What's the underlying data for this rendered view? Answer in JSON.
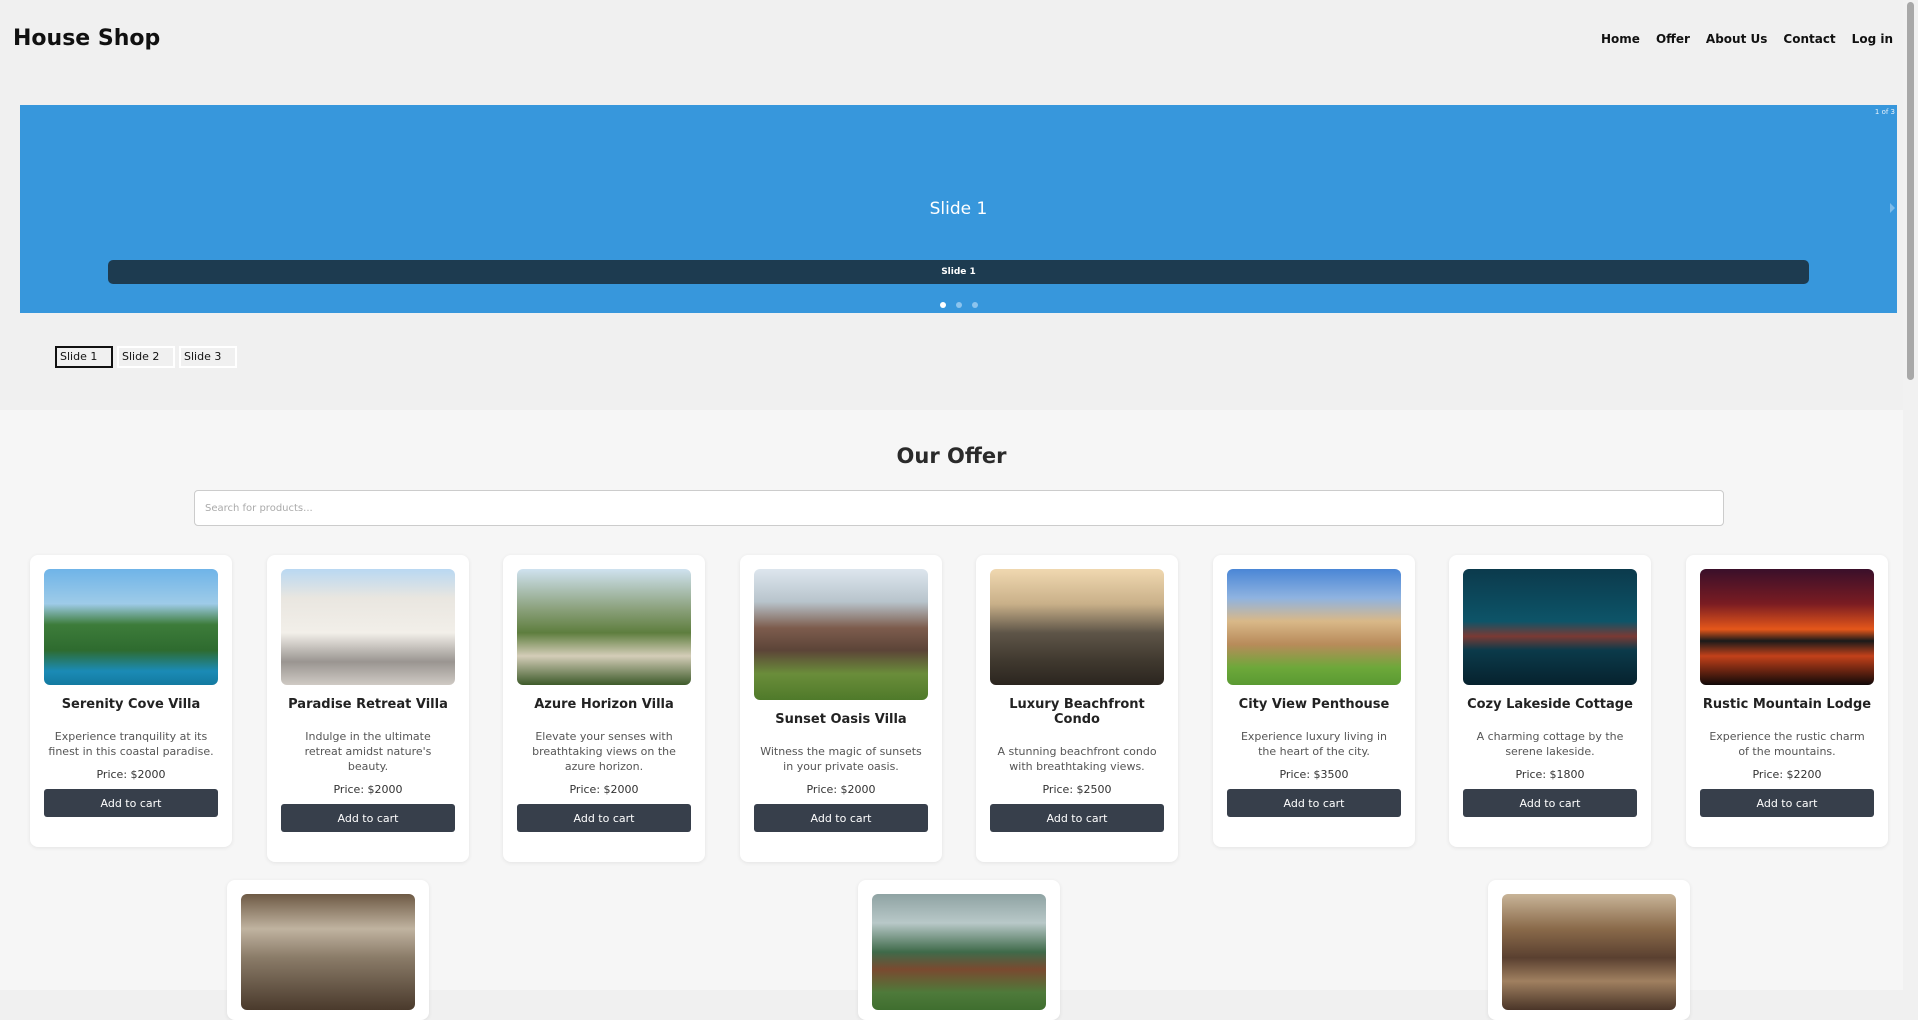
{
  "brand": "House Shop",
  "nav": [
    "Home",
    "Offer",
    "About Us",
    "Contact",
    "Log in"
  ],
  "slider": {
    "title": "Slide 1",
    "caption": "Slide 1",
    "counter": "1 of 3",
    "active_dot": 1,
    "dot_count": 3
  },
  "slide_tabs": [
    "Slide 1",
    "Slide 2",
    "Slide 3"
  ],
  "offer": {
    "title": "Our Offer",
    "search_placeholder": "Search for products..."
  },
  "products": [
    {
      "name": "Serenity Cove Villa",
      "desc": "Experience tranquility at its finest in this coastal paradise.",
      "price": "Price: $2000",
      "button": "Add to cart"
    },
    {
      "name": "Paradise Retreat Villa",
      "desc": "Indulge in the ultimate retreat amidst nature's beauty.",
      "price": "Price: $2000",
      "button": "Add to cart"
    },
    {
      "name": "Azure Horizon Villa",
      "desc": "Elevate your senses with breathtaking views on the azure horizon.",
      "price": "Price: $2000",
      "button": "Add to cart"
    },
    {
      "name": "Sunset Oasis Villa",
      "desc": "Witness the magic of sunsets in your private oasis.",
      "price": "Price: $2000",
      "button": "Add to cart"
    },
    {
      "name": "Luxury Beachfront Condo",
      "desc": "A stunning beachfront condo with breathtaking views.",
      "price": "Price: $2500",
      "button": "Add to cart"
    },
    {
      "name": "City View Penthouse",
      "desc": "Experience luxury living in the heart of the city.",
      "price": "Price: $3500",
      "button": "Add to cart"
    },
    {
      "name": "Cozy Lakeside Cottage",
      "desc": "A charming cottage by the serene lakeside.",
      "price": "Price: $1800",
      "button": "Add to cart"
    },
    {
      "name": "Rustic Mountain Lodge",
      "desc": "Experience the rustic charm of the mountains.",
      "price": "Price: $2200",
      "button": "Add to cart"
    }
  ]
}
